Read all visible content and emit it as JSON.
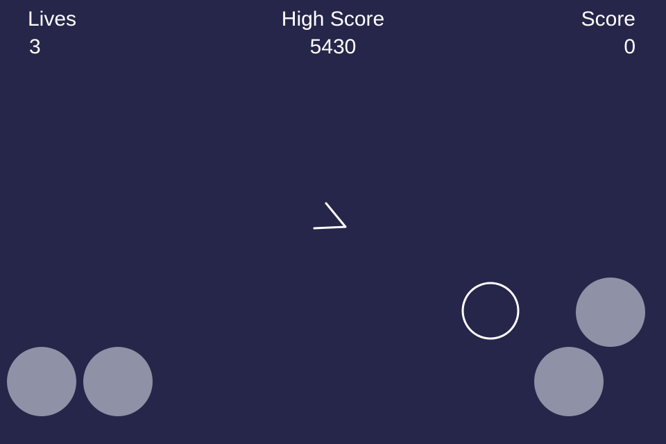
{
  "hud": {
    "lives_label": "Lives",
    "lives_value": "3",
    "high_score_label": "High Score",
    "high_score_value": "5430",
    "score_label": "Score",
    "score_value": "0"
  },
  "colors": {
    "background": "#26264a",
    "text": "#ffffff",
    "button": "#8f91a6",
    "outline": "#ffffff"
  },
  "controls": [
    "rotate-left",
    "rotate-right",
    "fire",
    "thrust"
  ]
}
